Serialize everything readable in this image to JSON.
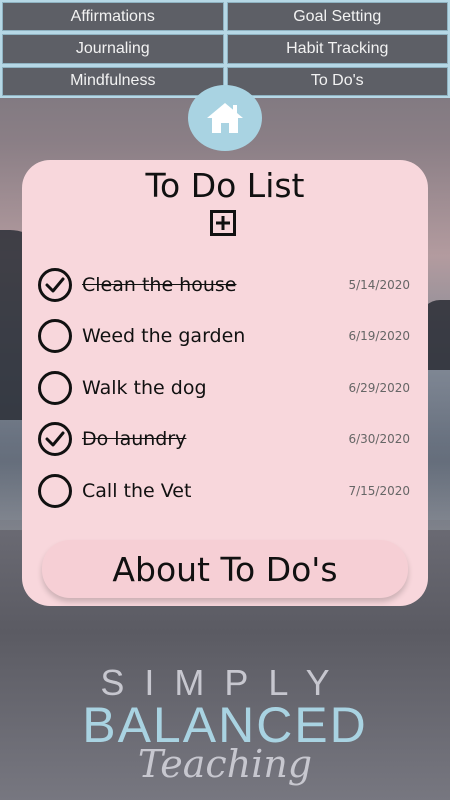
{
  "nav": {
    "items": [
      {
        "label": "Affirmations"
      },
      {
        "label": "Goal Setting"
      },
      {
        "label": "Journaling"
      },
      {
        "label": "Habit Tracking"
      },
      {
        "label": "Mindfulness"
      },
      {
        "label": "To Do's"
      }
    ]
  },
  "home": {
    "icon": "home-icon"
  },
  "todo_card": {
    "title": "To Do List",
    "add_icon": "plus-square-icon",
    "items": [
      {
        "text": "Clean the house",
        "date": "5/14/2020",
        "done": true
      },
      {
        "text": "Weed the garden",
        "date": "6/19/2020",
        "done": false
      },
      {
        "text": "Walk the dog",
        "date": "6/29/2020",
        "done": false
      },
      {
        "text": "Do laundry",
        "date": "6/30/2020",
        "done": true
      },
      {
        "text": "Call the Vet",
        "date": "7/15/2020",
        "done": false
      }
    ],
    "about_label": "About To Do's"
  },
  "logo": {
    "line1": "SIMPLY",
    "line2": "BALANCED",
    "line3": "Teaching"
  },
  "colors": {
    "accent_blue": "#a9d3e2",
    "card_pink": "#f8d7dc",
    "nav_gray": "#5d5f66"
  }
}
